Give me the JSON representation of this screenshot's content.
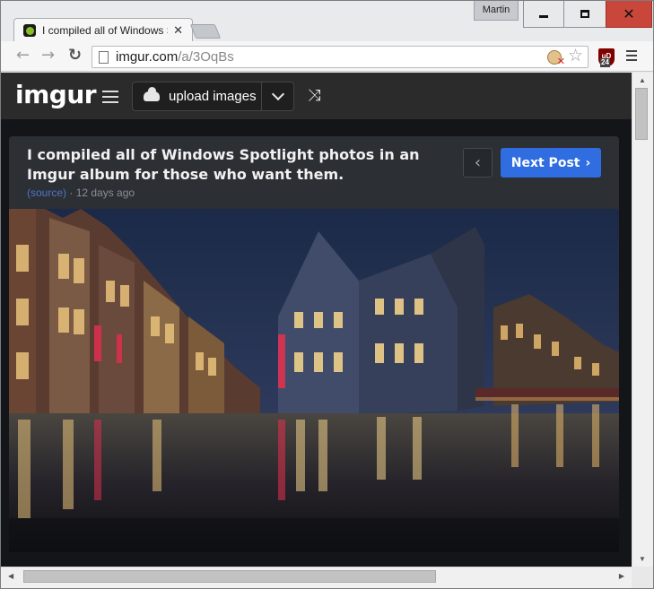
{
  "window": {
    "user_name": "Martin",
    "minimize_label": "",
    "maximize_label": "",
    "close_glyph": "✕"
  },
  "tab": {
    "title": "I compiled all of Windows Spotlight photos in an Imgur album for those who want them.",
    "close_glyph": "✕",
    "favicon": "imgur-favicon"
  },
  "toolbar": {
    "back_glyph": "←",
    "forward_glyph": "→",
    "reload_glyph": "↻",
    "url_host": "imgur.com",
    "url_path": "/a/3OqBs",
    "star_glyph": "☆",
    "extension_label": "uD",
    "extension_badge": "24"
  },
  "imgur": {
    "logo_text": "imgur",
    "upload_label": "upload images",
    "shuffle_glyph": "⤨",
    "accent_color": "#85bf25",
    "next_button_color": "#2f6de1"
  },
  "post": {
    "title": "I compiled all of Windows Spotlight photos in an Imgur album for those who want them.",
    "source_label": "(source)",
    "age": "· 12 days ago",
    "prev_glyph": "‹",
    "next_label": "Next Post",
    "next_glyph": "›",
    "image_description": "photo"
  }
}
